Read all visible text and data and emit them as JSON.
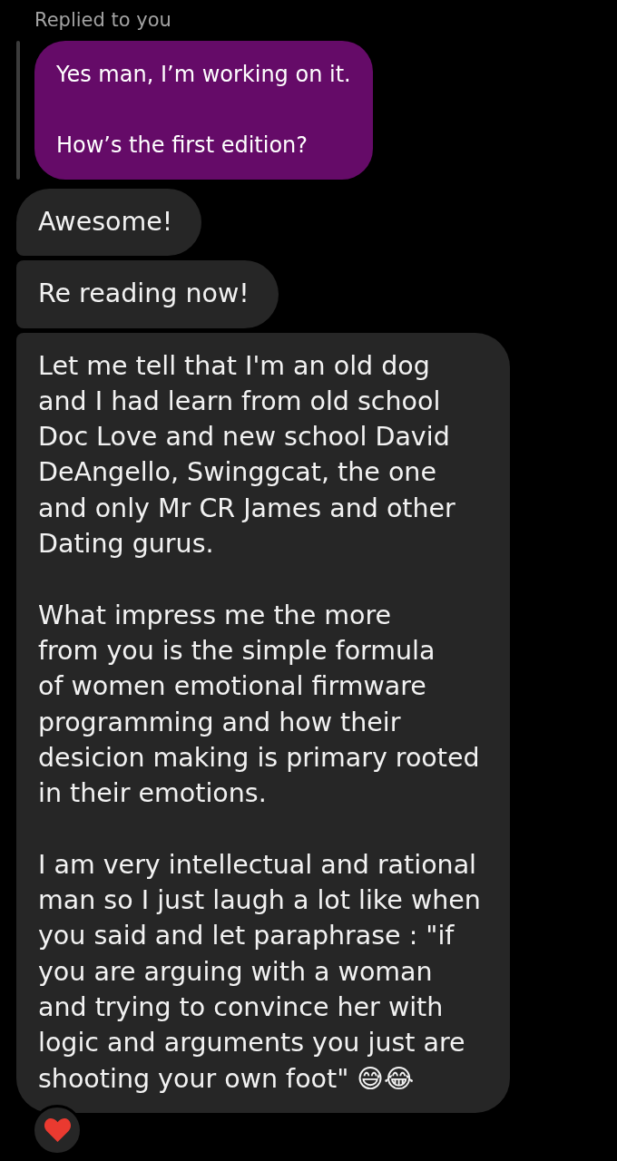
{
  "reply": {
    "label": "Replied to you",
    "text": "Yes man, I’m working on it.\n\nHow’s the first edition?"
  },
  "messages": [
    {
      "text": "Awesome!"
    },
    {
      "text": "Re reading now!"
    },
    {
      "text": "Let me tell that I'm an old dog\nand I had learn from old school\nDoc Love and new school David\nDeAngello, Swinggcat, the one\nand only Mr CR James and other\nDating gurus.\n\nWhat impress me the more\nfrom you is the simple formula\nof women emotional firmware\nprogramming and how their\ndesicion making is primary rooted\nin their emotions.\n\nI am very intellectual and rational\nman so I just laugh a lot like when\nyou said and let paraphrase : \"if\nyou are arguing with a woman\nand trying to convince her with\nlogic and arguments you just are\nshooting your own foot\" 😅😂",
      "reaction": {
        "kind": "heart"
      }
    }
  ]
}
